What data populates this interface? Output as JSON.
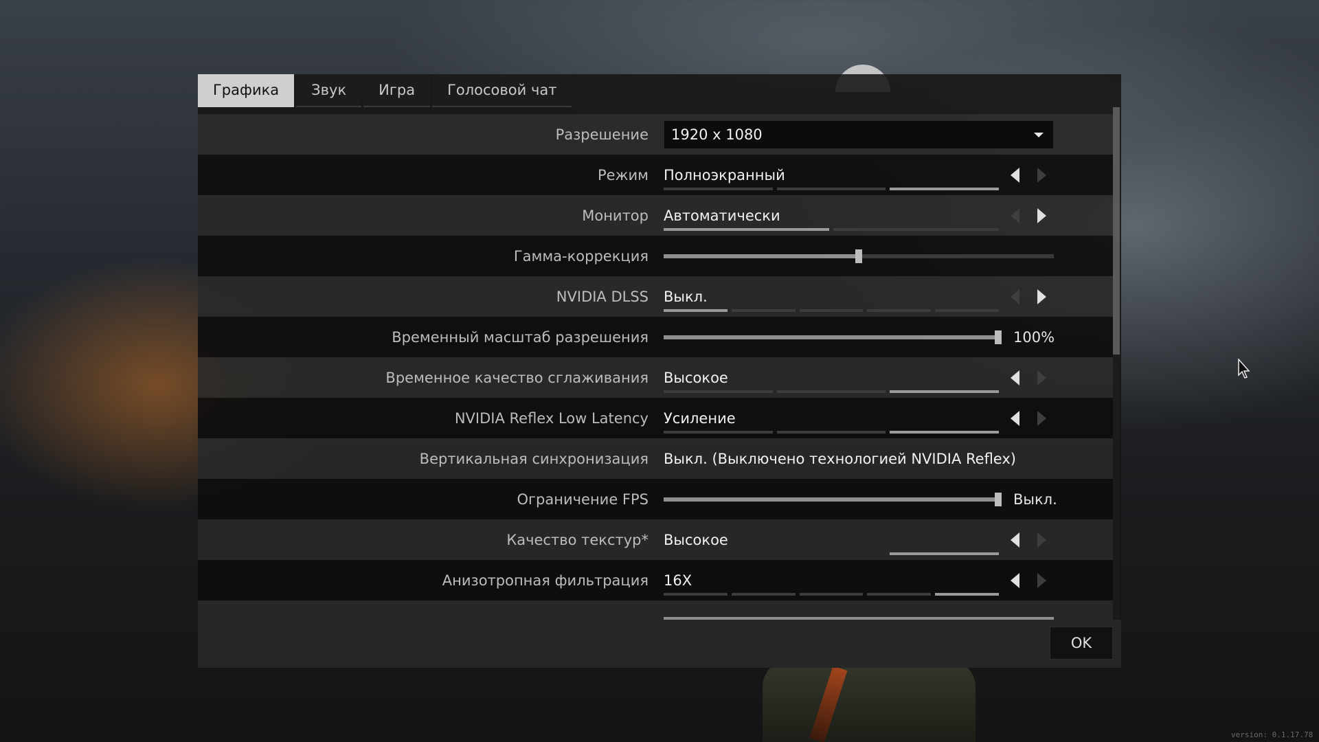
{
  "tabs": [
    {
      "label": "Графика",
      "active": true
    },
    {
      "label": "Звук",
      "active": false
    },
    {
      "label": "Игра",
      "active": false
    },
    {
      "label": "Голосовой чат",
      "active": false
    }
  ],
  "settings": {
    "resolution": {
      "label": "Разрешение",
      "value": "1920 x 1080"
    },
    "mode": {
      "label": "Режим",
      "value": "Полноэкранный"
    },
    "monitor": {
      "label": "Монитор",
      "value": "Автоматически"
    },
    "gamma": {
      "label": "Гамма-коррекция",
      "level": 0.5
    },
    "dlss": {
      "label": "NVIDIA DLSS",
      "value": "Выкл."
    },
    "temporal_scale": {
      "label": "Временный масштаб разрешения",
      "value": "100%",
      "level": 1.0
    },
    "temporal_aa": {
      "label": "Временное качество сглаживания",
      "value": "Высокое"
    },
    "reflex": {
      "label": "NVIDIA Reflex Low Latency",
      "value": "Усиление"
    },
    "vsync": {
      "label": "Вертикальная синхронизация",
      "value": "Выкл. (Выключено технологией NVIDIA Reflex)"
    },
    "fps_limit": {
      "label": "Ограничение FPS",
      "value": "Выкл.",
      "level": 1.0
    },
    "texture_quality": {
      "label": "Качество текстур*",
      "value": "Высокое"
    },
    "anisotropic": {
      "label": "Анизотропная фильтрация",
      "value": "16X"
    }
  },
  "footer": {
    "ok_label": "OK"
  },
  "version": "version: 0.1.17.78",
  "colors": {
    "active_tab": "#cfcfcf",
    "panel": "#161616",
    "accent": "#9a9a9a"
  }
}
